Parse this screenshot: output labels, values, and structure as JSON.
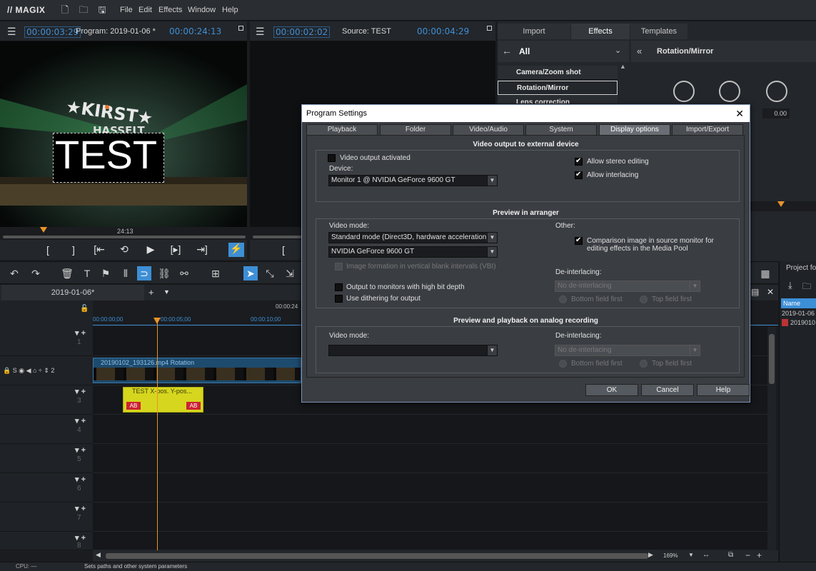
{
  "app": {
    "logo": "MAGIX",
    "menu": [
      "File",
      "Edit",
      "Effects",
      "Window",
      "Help"
    ]
  },
  "program_monitor": {
    "timecode_left": "00:00:03:29",
    "title": "Program: 2019-01-06 *",
    "timecode_right": "00:00:24:13",
    "overlay_text": "TEST",
    "ruler_label": "24:13"
  },
  "source_monitor": {
    "timecode_left": "00:00:02:02",
    "title": "Source: TEST",
    "timecode_right": "00:00:04:29"
  },
  "media_pool": {
    "tabs": [
      "Import",
      "Effects",
      "Templates"
    ],
    "category": "All",
    "items": [
      "Camera/Zoom shot",
      "Rotation/Mirror",
      "Lens correction"
    ],
    "panel_title": "Rotation/Mirror",
    "value": "0.00"
  },
  "timeline": {
    "tab": "2019-01-06*",
    "ruler": [
      "00:00:00;00",
      "00:00:05;00",
      "00:00:10;00",
      "00:00:24"
    ],
    "tracks": [
      "1",
      "2",
      "3",
      "4",
      "5",
      "6",
      "7",
      "8"
    ],
    "clip_video": "20190102_193126.mp4   Rotation",
    "clip_title": "TEST   X-pos.  Y-pos...",
    "zoom": "169%"
  },
  "project_panel": {
    "title": "Project fo",
    "column": "Name",
    "items": [
      "2019-01-06",
      "2019010"
    ]
  },
  "status": {
    "cpu": "CPU: —",
    "hint": "Sets paths and other system parameters"
  },
  "dialog": {
    "title": "Program Settings",
    "tabs": [
      "Playback",
      "Folder",
      "Video/Audio",
      "System",
      "Display options",
      "Import/Export"
    ],
    "group1": {
      "title": "Video output to external device",
      "video_output": "Video output activated",
      "device_label": "Device:",
      "device_value": "Monitor 1 @ NVIDIA GeForce 9600 GT",
      "stereo": "Allow stereo editing",
      "interlacing": "Allow interlacing"
    },
    "group2": {
      "title": "Preview in arranger",
      "video_mode_label": "Video mode:",
      "video_mode_value": "Standard mode (Direct3D, hardware acceleration)",
      "adapter_value": "NVIDIA GeForce 9600 GT",
      "vbi": "Image formation in vertical blank intervals (VBI)",
      "high_bit": "Output to monitors with high bit depth",
      "dither": "Use dithering for output",
      "other_label": "Other:",
      "comparison": "Comparison image in source monitor for editing effects in the Media Pool",
      "deint_label": "De-interlacing:",
      "deint_value": "No de-interlacing",
      "bottom": "Bottom field first",
      "top": "Top field first"
    },
    "group3": {
      "title": "Preview and playback on analog recording",
      "video_mode_label": "Video mode:",
      "deint_label": "De-interlacing:",
      "deint_value": "No de-interlacing",
      "bottom": "Bottom field first",
      "top": "Top field first"
    },
    "buttons": {
      "ok": "OK",
      "cancel": "Cancel",
      "help": "Help"
    }
  }
}
